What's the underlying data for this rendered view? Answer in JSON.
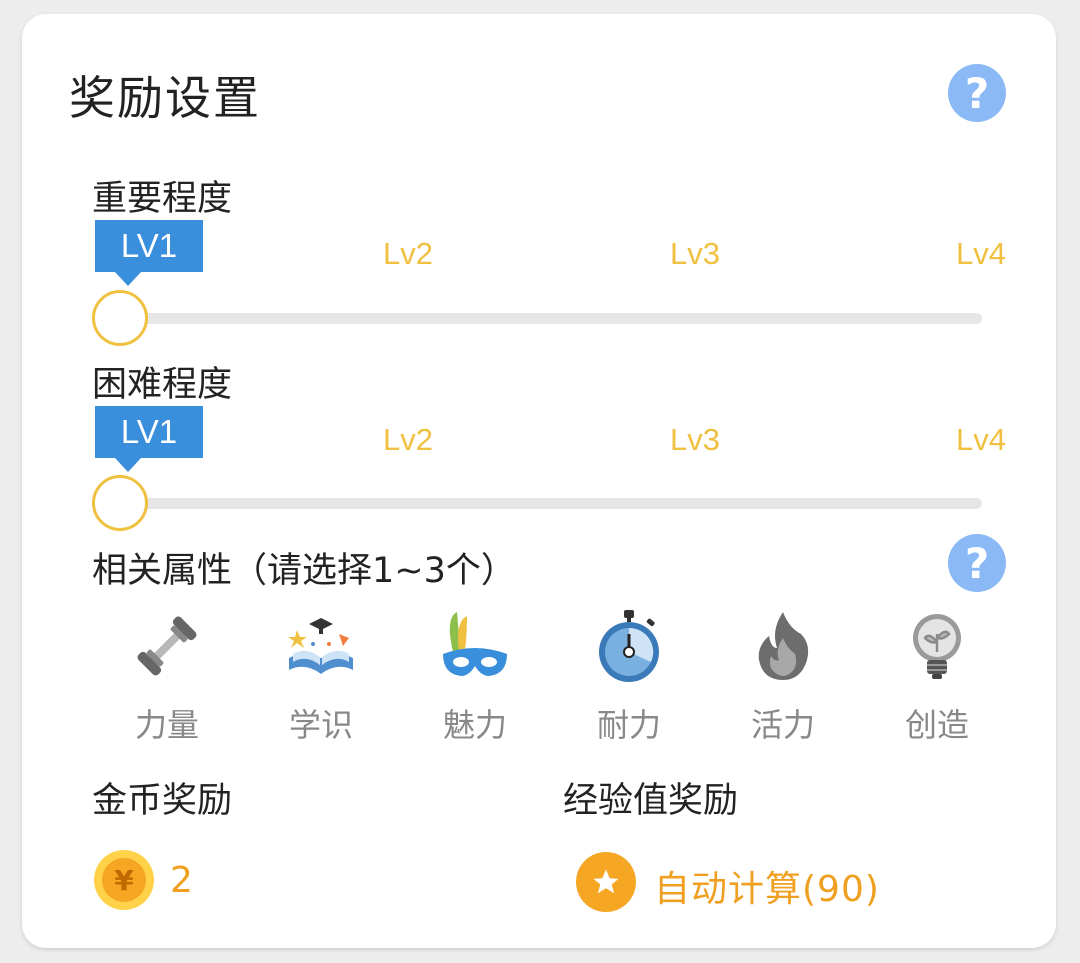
{
  "title": "奖励设置",
  "importance": {
    "label": "重要程度",
    "selected_label": "LV1",
    "levels": [
      "Lv2",
      "Lv3",
      "Lv4"
    ],
    "value": 1
  },
  "difficulty": {
    "label": "困难程度",
    "selected_label": "LV1",
    "levels": [
      "Lv2",
      "Lv3",
      "Lv4"
    ],
    "value": 1
  },
  "attributes": {
    "label": "相关属性（请选择1~3个）",
    "items": [
      {
        "label": "力量",
        "icon": "dumbbell-icon"
      },
      {
        "label": "学识",
        "icon": "book-icon"
      },
      {
        "label": "魅力",
        "icon": "mask-icon"
      },
      {
        "label": "耐力",
        "icon": "stopwatch-icon"
      },
      {
        "label": "活力",
        "icon": "flame-icon"
      },
      {
        "label": "创造",
        "icon": "lightbulb-icon"
      }
    ]
  },
  "coin_reward": {
    "label": "金币奖励",
    "value": "2",
    "icon_char": "¥"
  },
  "exp_reward": {
    "label": "经验值奖励",
    "value": "自动计算(90)"
  },
  "colors": {
    "accent_blue": "#3a8fdd",
    "help_blue": "#8bb9f5",
    "level_yellow": "#f0c040",
    "reward_orange": "#f0a020"
  }
}
